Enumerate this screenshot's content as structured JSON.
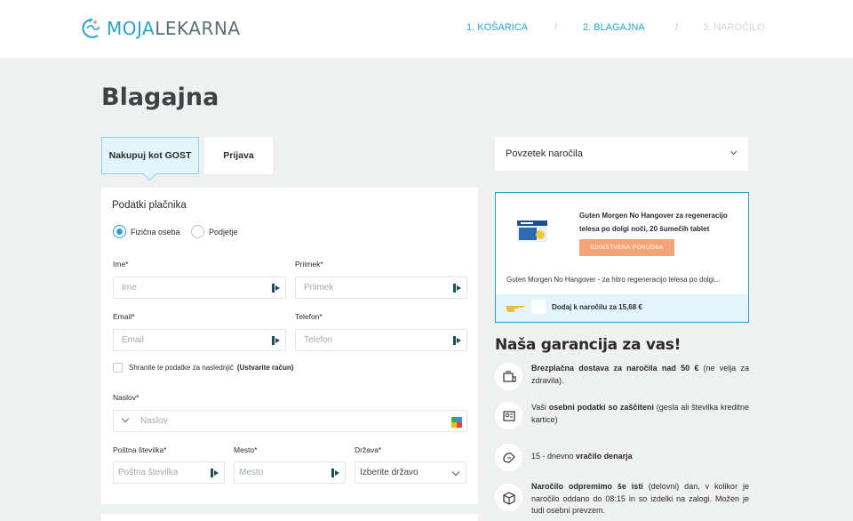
{
  "header": {
    "logo_part1": "MOJA",
    "logo_part2": "LEKARNA",
    "steps": [
      {
        "label": "1. KOŠARICA",
        "state": "done"
      },
      {
        "label": "2. BLAGAJNA",
        "state": "current"
      },
      {
        "label": "3. NAROČILO",
        "state": "inactive"
      }
    ],
    "separator": "/"
  },
  "page": {
    "title": "Blagajna"
  },
  "tabs": [
    {
      "label": "Nakupuj kot GOST",
      "active": true
    },
    {
      "label": "Prijava",
      "active": false
    }
  ],
  "form": {
    "section_title": "Podatki plačnika",
    "person_types": [
      {
        "label": "Fizična oseba",
        "checked": true
      },
      {
        "label": "Podjetje",
        "checked": false
      }
    ],
    "first_name": {
      "label": "Ime*",
      "placeholder": "Ime"
    },
    "last_name": {
      "label": "Priimek*",
      "placeholder": "Priimek"
    },
    "email": {
      "label": "Email*",
      "placeholder": "Email"
    },
    "phone": {
      "label": "Telefon*",
      "placeholder": "Telefon"
    },
    "save_data": {
      "label": "Shranite te podatke za naslednjič",
      "link": "(Ustvarite račun)"
    },
    "address": {
      "label": "Naslov*",
      "placeholder": "Naslov"
    },
    "postal": {
      "label": "Poštna številka*",
      "placeholder": "Poštna številka"
    },
    "city": {
      "label": "Mesto*",
      "placeholder": "Mesto"
    },
    "country": {
      "label": "Država*",
      "value": "Izberite državo"
    }
  },
  "summary": {
    "title": "Povzetek naročila"
  },
  "offer": {
    "title": "Guten Morgen No Hangover za regeneracijo telesa po dolgi noči, 20 šumečih tablet",
    "badge": "EDINSTVENA PONUDBA",
    "description": "Guten Morgen No Hangover - za hitro regeneracijo telesa po dolgi...",
    "add_label": "Dodaj k naročilu za 15,68 €"
  },
  "guarantee": {
    "title": "Naša garancija za vas!",
    "items": [
      {
        "icon": "delivery-icon",
        "bold": "Brezplačna dostava za naročila nad 50 €",
        "text": " (ne velja za zdravila)."
      },
      {
        "icon": "id-card-icon",
        "pre": "Vaši ",
        "bold": "osebni podatki so zaščiteni",
        "text": " (gesla ali številka kreditne kartice)"
      },
      {
        "icon": "money-back-icon",
        "pre": "15 - dnevno ",
        "bold": "vračilo denarja",
        "text": ""
      },
      {
        "icon": "package-icon",
        "bold": "Naročilo odpremimo še isti",
        "text": " (delovni) dan, v kolikor je naročilo oddano do 08:15 in so izdelki na zalogi. Možen je tudi osebni prevzem."
      }
    ]
  },
  "colors": {
    "accent": "#29a3cc",
    "badge": "#f6a477",
    "background": "#eff0f0"
  }
}
